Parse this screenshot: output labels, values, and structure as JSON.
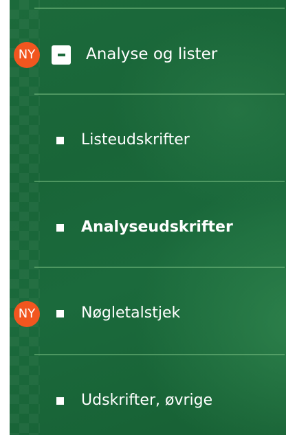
{
  "menu": {
    "section": {
      "badge": "NY",
      "label": "Analyse og lister",
      "toggle_icon": "minus-square-icon"
    },
    "items": [
      {
        "label": "Listeudskrifter",
        "badge": "",
        "active": false
      },
      {
        "label": "Analyseudskrifter",
        "badge": "",
        "active": true
      },
      {
        "label": "Nøgletalstjek",
        "badge": "NY",
        "active": false
      },
      {
        "label": "Udskrifter, øvrige",
        "badge": "",
        "active": false
      }
    ]
  },
  "colors": {
    "background": "#1c6a3b",
    "badge": "#f2561f",
    "text": "#ffffff",
    "divider": "#78be82"
  }
}
